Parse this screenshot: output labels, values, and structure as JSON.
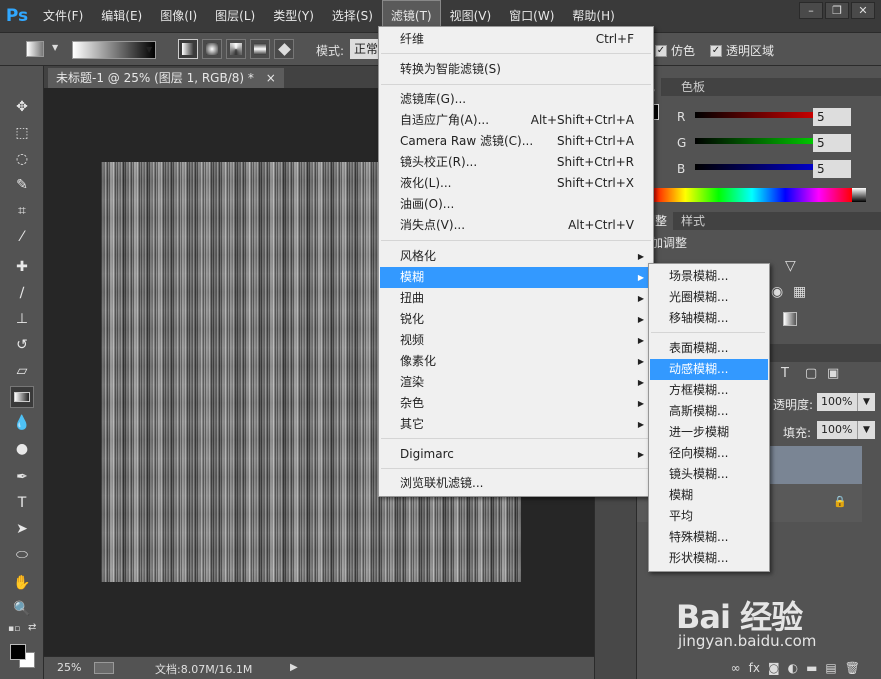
{
  "app": {
    "logo": "Ps"
  },
  "menubar": {
    "items": [
      "文件(F)",
      "编辑(E)",
      "图像(I)",
      "图层(L)",
      "类型(Y)",
      "选择(S)",
      "滤镜(T)",
      "视图(V)",
      "窗口(W)",
      "帮助(H)"
    ],
    "active_index": 6
  },
  "window_controls": {
    "minimize": "–",
    "restore": "❐",
    "close": "✕"
  },
  "options_bar": {
    "mode_label": "模式:",
    "mode_value": "正常",
    "dither_label": "仿色",
    "dither_checked": true,
    "transparency_label": "透明区域",
    "transparency_checked": true
  },
  "document": {
    "tab_title": "未标题-1 @ 25% (图层 1, RGB/8) *",
    "close_glyph": "×"
  },
  "status_bar": {
    "zoom": "25%",
    "doc_info": "文档:8.07M/16.1M"
  },
  "filter_menu": {
    "items": [
      {
        "label": "纤维",
        "shortcut": "Ctrl+F"
      },
      {
        "label": "转换为智能滤镜(S)",
        "shortcut": ""
      },
      {
        "label": "滤镜库(G)...",
        "shortcut": ""
      },
      {
        "label": "自适应广角(A)...",
        "shortcut": "Alt+Shift+Ctrl+A"
      },
      {
        "label": "Camera Raw 滤镜(C)...",
        "shortcut": "Shift+Ctrl+A"
      },
      {
        "label": "镜头校正(R)...",
        "shortcut": "Shift+Ctrl+R"
      },
      {
        "label": "液化(L)...",
        "shortcut": "Shift+Ctrl+X"
      },
      {
        "label": "油画(O)...",
        "shortcut": ""
      },
      {
        "label": "消失点(V)...",
        "shortcut": "Alt+Ctrl+V"
      },
      {
        "label": "风格化",
        "shortcut": ""
      },
      {
        "label": "模糊",
        "shortcut": ""
      },
      {
        "label": "扭曲",
        "shortcut": ""
      },
      {
        "label": "锐化",
        "shortcut": ""
      },
      {
        "label": "视频",
        "shortcut": ""
      },
      {
        "label": "像素化",
        "shortcut": ""
      },
      {
        "label": "渲染",
        "shortcut": ""
      },
      {
        "label": "杂色",
        "shortcut": ""
      },
      {
        "label": "其它",
        "shortcut": ""
      },
      {
        "label": "Digimarc",
        "shortcut": ""
      },
      {
        "label": "浏览联机滤镜...",
        "shortcut": ""
      }
    ],
    "highlighted": "模糊"
  },
  "blur_submenu": {
    "items": [
      "场景模糊...",
      "光圈模糊...",
      "移轴模糊...",
      "表面模糊...",
      "动感模糊...",
      "方框模糊...",
      "高斯模糊...",
      "进一步模糊",
      "径向模糊...",
      "镜头模糊...",
      "模糊",
      "平均",
      "特殊模糊...",
      "形状模糊..."
    ],
    "highlighted": "动感模糊..."
  },
  "color_panel": {
    "tabs": [
      "色",
      "色板"
    ],
    "channels": [
      {
        "label": "R",
        "value": "5"
      },
      {
        "label": "G",
        "value": "5"
      },
      {
        "label": "B",
        "value": "5"
      }
    ]
  },
  "adjustments_panel": {
    "tabs": [
      "调整",
      "样式"
    ],
    "title": "加调整"
  },
  "layers_panel": {
    "opacity_label": "透明度:",
    "opacity_value": "100%",
    "fill_label": "填充:",
    "fill_value": "100%",
    "lock_icon": "🔒"
  },
  "watermark": {
    "main": "Bai 经验",
    "sub": "jingyan.baidu.com"
  },
  "colors": {
    "highlight": "#3399ff",
    "ps_blue": "#31a8ff"
  }
}
